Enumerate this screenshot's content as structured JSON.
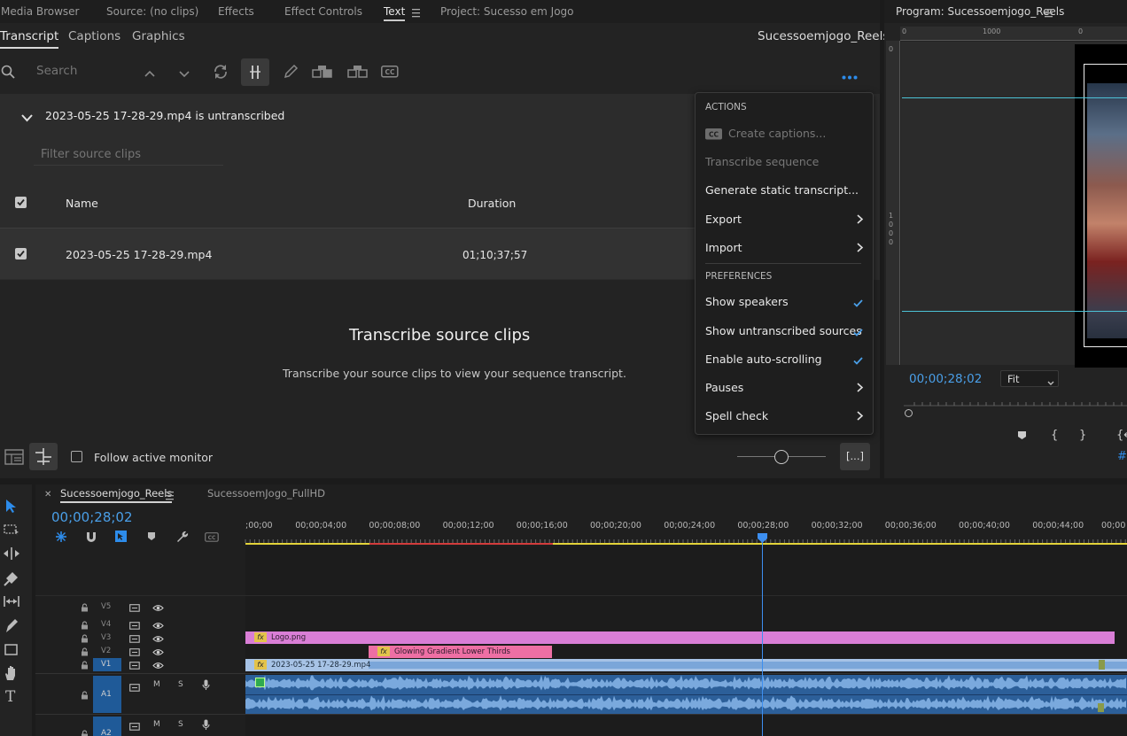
{
  "panels": {
    "top_tabs": [
      "Media Browser",
      "Source: (no clips)",
      "Effects",
      "Effect Controls",
      "Text",
      "Project: Sucesso em Jogo"
    ],
    "active_top_tab": "Text",
    "sub_tabs": [
      "Transcript",
      "Captions",
      "Graphics"
    ],
    "sequence_name": "Sucessoemjogo_Reels"
  },
  "toolbar": {
    "search_placeholder": "Search"
  },
  "clip_section": {
    "header": "2023-05-25 17-28-29.mp4 is untranscribed",
    "filter_placeholder": "Filter source clips",
    "columns": [
      "Name",
      "Duration"
    ],
    "rows": [
      {
        "name": "2023-05-25 17-28-29.mp4",
        "duration": "01;10;37;57",
        "checked": true
      }
    ]
  },
  "empty_state": {
    "title": "Transcribe source clips",
    "description": "Transcribe your source clips to view your sequence transcript."
  },
  "footer": {
    "follow_monitor": "Follow active monitor",
    "ellipsis_btn": "[...]"
  },
  "menu": {
    "actions_heading": "ACTIONS",
    "create_captions": "Create captions...",
    "transcribe_sequence": "Transcribe sequence",
    "generate_static": "Generate static transcript...",
    "export": "Export",
    "import": "Import",
    "preferences_heading": "PREFERENCES",
    "show_speakers": "Show speakers",
    "show_untranscribed": "Show untranscribed sources",
    "enable_autoscroll": "Enable auto-scrolling",
    "pauses": "Pauses",
    "spell_check": "Spell check"
  },
  "program_monitor": {
    "title": "Program: Sucessoemjogo_Reels",
    "timecode": "00;00;28;02",
    "fit": "Fit",
    "ruler_1000": "1000",
    "ruler_0": "0",
    "vruler": [
      "1",
      "0",
      "0",
      "0"
    ]
  },
  "timeline": {
    "tabs": [
      "Sucessoemjogo_Reels",
      "SucessoemJogo_FullHD"
    ],
    "timecode": "00;00;28;02",
    "ruler_labels": [
      ";00;00",
      "00;00;04;00",
      "00;00;08;00",
      "00;00;12;00",
      "00;00;16;00",
      "00;00;20;00",
      "00;00;24;00",
      "00;00;28;00",
      "00;00;32;00",
      "00;00;36;00",
      "00;00;40;00",
      "00;00;44;00",
      "00;00"
    ],
    "video_tracks": [
      "V5",
      "V4",
      "V3",
      "V2",
      "V1"
    ],
    "audio_tracks": [
      "A1",
      "A2"
    ],
    "mute": "M",
    "solo": "S",
    "clips": {
      "logo": "Logo.png",
      "lower_thirds": "Glowing Gradient Lower Thirds",
      "main": "2023-05-25 17-28-29.mp4"
    },
    "fx": "fx"
  },
  "colors": {
    "accent": "#2d8ceb",
    "timecode": "#4a9fe8",
    "logo_clip": "#d97ed6",
    "lower_thirds_clip": "#ee6fa4",
    "v1_clip": "#a7c3e6",
    "audio_clip": "#3d6fa6",
    "audio_wave": "#7aa9dd"
  }
}
